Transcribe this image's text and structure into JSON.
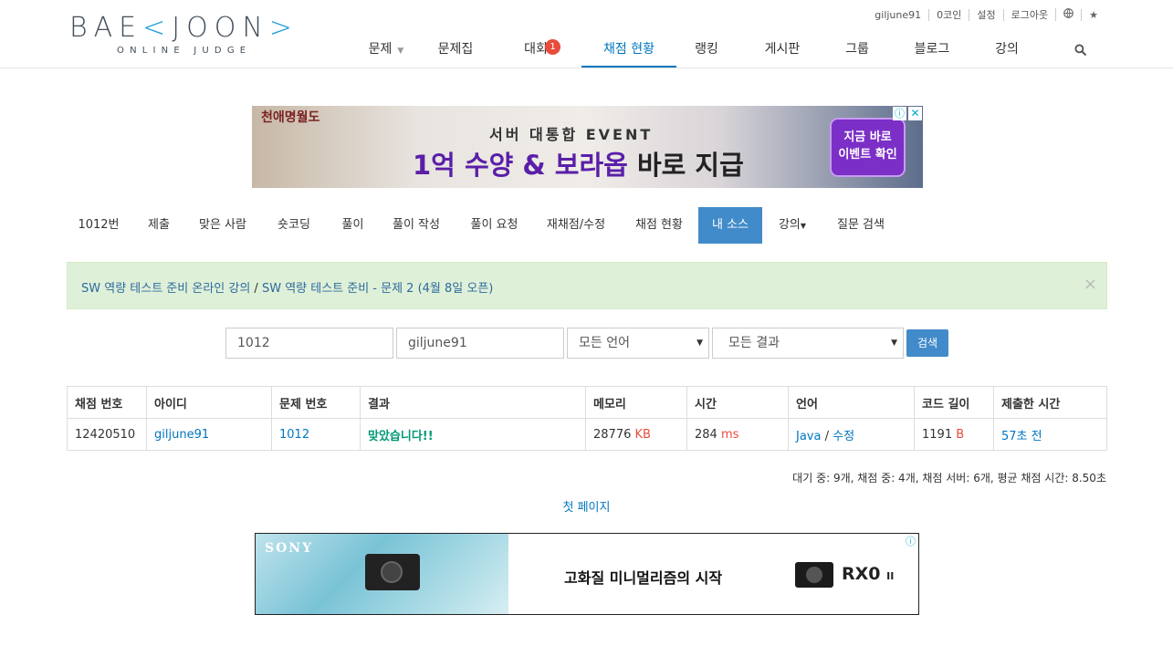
{
  "header": {
    "logo_main_left": "BAE",
    "logo_main_bracket_left": "<",
    "logo_main_mid": "JOON",
    "logo_main_bracket_right": ">",
    "logo_sub": "ONLINE JUDGE",
    "topbar": [
      "giljune91",
      "0코인",
      "설정",
      "로그아웃"
    ],
    "topbar_icons": [
      "globe-icon",
      "star-icon"
    ],
    "nav": [
      {
        "label": "문제",
        "caret": true
      },
      {
        "label": "문제집"
      },
      {
        "label": "대회",
        "badge": "1"
      },
      {
        "label": "채점 현황",
        "active": true
      },
      {
        "label": "랭킹"
      },
      {
        "label": "게시판"
      },
      {
        "label": "그룹"
      },
      {
        "label": "블로그"
      },
      {
        "label": "강의"
      }
    ],
    "search_icon": "search-icon"
  },
  "ad_top": {
    "game_logo": "천애명월도",
    "event": "서버 대통합 EVENT",
    "headline_purple": "1억 수양 & 보라옵",
    "headline_dark": " 바로 지급",
    "cta_line1": "지금 바로",
    "cta_line2": "이벤트 확인",
    "info_glyph": "ⓘ",
    "close_glyph": "✕"
  },
  "subnav": [
    {
      "label": "1012번"
    },
    {
      "label": "제출"
    },
    {
      "label": "맞은 사람"
    },
    {
      "label": "숏코딩"
    },
    {
      "label": "풀이"
    },
    {
      "label": "풀이 작성"
    },
    {
      "label": "풀이 요청"
    },
    {
      "label": "재채점/수정"
    },
    {
      "label": "채점 현황"
    },
    {
      "label": "내 소스",
      "active": true
    },
    {
      "label": "강의",
      "dropdown": true
    },
    {
      "label": "질문 검색"
    }
  ],
  "alert": {
    "link1": "SW 역량 테스트 준비 온라인 강의",
    "sep": " / ",
    "link2": "SW 역량 테스트 준비 - 문제 2 (4월 8일 오픈)",
    "close": "×"
  },
  "search": {
    "problem_id": "1012",
    "user_id": "giljune91",
    "language": "모든 언어",
    "result": "모든 결과",
    "button": "검색"
  },
  "table": {
    "headers": [
      "채점 번호",
      "아이디",
      "문제 번호",
      "결과",
      "메모리",
      "시간",
      "언어",
      "코드 길이",
      "제출한 시간"
    ],
    "rows": [
      {
        "submission_id": "12420510",
        "user": "giljune91",
        "problem": "1012",
        "result": "맞았습니다!!",
        "memory": "28776",
        "memory_unit": "KB",
        "time": "284",
        "time_unit": "ms",
        "language": "Java",
        "lang_sep": " / ",
        "edit": "수정",
        "code_length": "1191",
        "code_unit": "B",
        "submitted": "57초 전"
      }
    ]
  },
  "stats": "대기 중: 9개, 채점 중: 4개, 채점 서버: 6개, 평균 채점 시간: 8.50초",
  "pagination": {
    "first": "첫 페이지"
  },
  "ad_bottom": {
    "brand": "SONY",
    "tagline": "고화질 미니멀리즘의 시작",
    "model": "RX0",
    "model_suffix": "II",
    "info_glyph": "ⓘ"
  }
}
